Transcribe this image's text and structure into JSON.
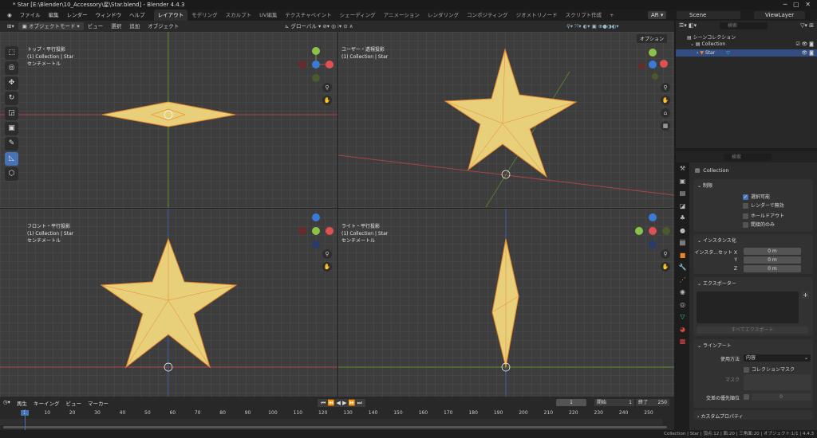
{
  "title": "* Star [E:\\Blender\\10_Accessory\\星\\Star.blend] - Blender 4.4.3",
  "menu": [
    "ファイル",
    "編集",
    "レンダー",
    "ウィンドウ",
    "ヘルプ"
  ],
  "workspaces": [
    "レイアウト",
    "モデリング",
    "スカルプト",
    "UV編集",
    "テクスチャペイント",
    "シェーディング",
    "アニメーション",
    "レンダリング",
    "コンポジティング",
    "ジオメトリノード",
    "スクリプト作成",
    "+"
  ],
  "top_right": {
    "ar": "AR",
    "scene": "Scene",
    "view_layer": "ViewLayer"
  },
  "viewport_header": {
    "mode": "オブジェクトモード",
    "items": [
      "ビュー",
      "選択",
      "追加",
      "オブジェクト"
    ],
    "orientation": "グローバル",
    "options": "オプション"
  },
  "viewports": [
    {
      "title": "トップ・平行投影",
      "collection": "(1) Collection | Star",
      "unit": "センチメートル"
    },
    {
      "title": "ユーザー・透視投影",
      "collection": "(1) Collection | Star",
      "unit": ""
    },
    {
      "title": "フロント・平行投影",
      "collection": "(1) Collection | Star",
      "unit": "センチメートル"
    },
    {
      "title": "ライト・平行投影",
      "collection": "(1) Collection | Star",
      "unit": "センチメートル"
    }
  ],
  "outliner": {
    "search_placeholder": "検索",
    "scene_collection": "シーンコレクション",
    "collection": "Collection",
    "object": "Star"
  },
  "properties": {
    "search_placeholder": "検索",
    "context": "Collection",
    "restrictions": {
      "title": "制限",
      "selectable": "選択可能",
      "disable_render": "レンダーで無効",
      "holdout": "ホールドアウト",
      "indirect_only": "間接的のみ"
    },
    "instancing": {
      "title": "インスタンス化",
      "offset_label": "インスタ...セット X",
      "y": "Y",
      "z": "Z",
      "x_val": "0 m",
      "y_val": "0 m",
      "z_val": "0 m"
    },
    "exporters": {
      "title": "エクスポーター",
      "export_all": "すべてエクスポート"
    },
    "lineart": {
      "title": "ラインアート",
      "usage_label": "使用方法",
      "usage_value": "内容",
      "collection_mask": "コレクションマスク",
      "mask": "マスク",
      "priority_label": "交差の優先順位",
      "priority_value": "0"
    },
    "custom_props": "カスタムプロパティ"
  },
  "timeline": {
    "menu": [
      "再生",
      "キーイング",
      "ビュー",
      "マーカー"
    ],
    "current_frame": "1",
    "start_label": "開始",
    "start": "1",
    "end_label": "終了",
    "end": "250",
    "ticks": [
      "1",
      "10",
      "20",
      "30",
      "40",
      "50",
      "60",
      "70",
      "80",
      "90",
      "100",
      "110",
      "120",
      "130",
      "140",
      "150",
      "160",
      "170",
      "180",
      "190",
      "200",
      "210",
      "220",
      "230",
      "240",
      "250"
    ]
  },
  "statusbar": "Collection | Star | 頂点:12 | 面:20 | 三角面:20 | オブジェクト:1/1 | 4.4.3",
  "colors": {
    "accent": "#4772b3",
    "star_fill": "#e8cf7a",
    "star_edge": "#e8862a"
  }
}
